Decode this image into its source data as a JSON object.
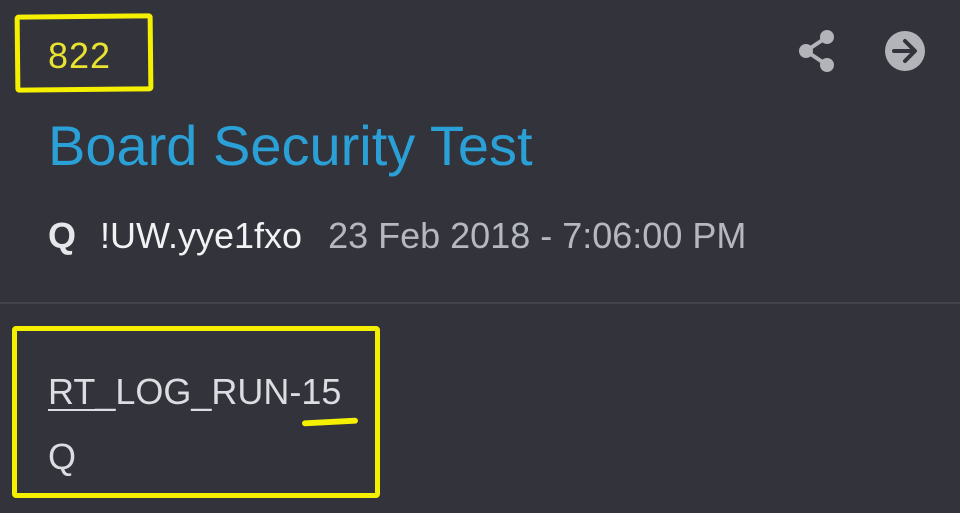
{
  "post": {
    "number": "822",
    "title": "Board Security Test",
    "author": "Q",
    "tripcode": "!UW.yye1fxo",
    "timestamp": "23 Feb 2018 - 7:06:00 PM",
    "body_prefix": "RT_",
    "body_rest": "LOG_RUN-15",
    "body_signature": "Q"
  },
  "actions": {
    "share_icon": "share-icon",
    "open_icon": "arrow-right-circle-icon"
  },
  "colors": {
    "background": "#32333b",
    "title": "#2aa0d6",
    "post_number": "#e8e230",
    "highlight": "#f4f000"
  }
}
